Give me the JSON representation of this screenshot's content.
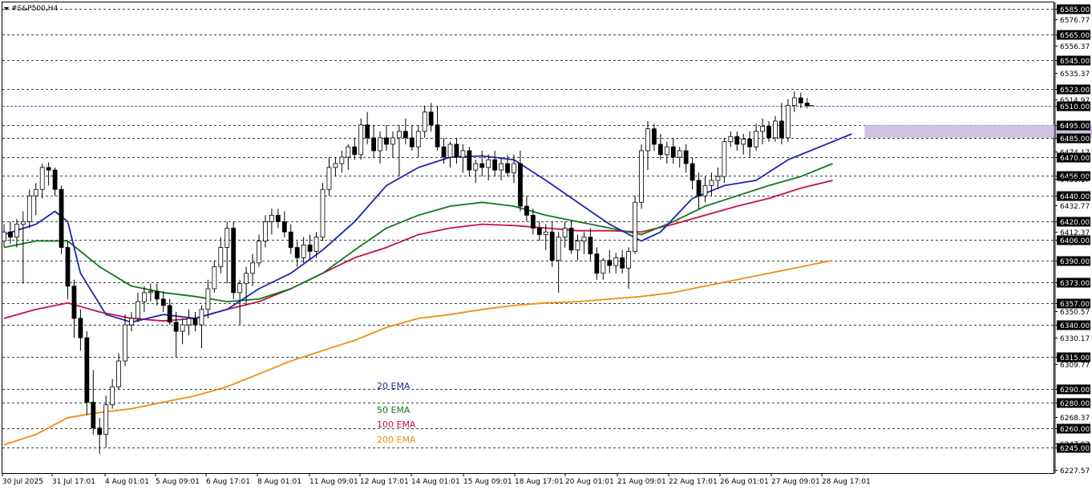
{
  "chart_data": {
    "type": "candlestick",
    "symbol_label": "#S&P500,H4",
    "price_axis": {
      "ylim": [
        6225,
        6590
      ],
      "ticks": [
        {
          "value": 6585.0,
          "label": "6585.00",
          "kind": "level"
        },
        {
          "value": 6576.77,
          "label": "6576.77",
          "kind": "scale"
        },
        {
          "value": 6565.0,
          "label": "6565.00",
          "kind": "level"
        },
        {
          "value": 6556.37,
          "label": "6556.37",
          "kind": "scale"
        },
        {
          "value": 6545.0,
          "label": "6545.00",
          "kind": "level"
        },
        {
          "value": 6535.37,
          "label": "6535.37",
          "kind": "scale"
        },
        {
          "value": 6523.0,
          "label": "6523.00",
          "kind": "level"
        },
        {
          "value": 6514.97,
          "label": "6514.97",
          "kind": "scale"
        },
        {
          "value": 6510.0,
          "label": "6510.00",
          "kind": "price"
        },
        {
          "value": 6495.0,
          "label": "6495.00",
          "kind": "level"
        },
        {
          "value": 6485.0,
          "label": "6485.00",
          "kind": "level"
        },
        {
          "value": 6474.17,
          "label": "6474.17",
          "kind": "scale"
        },
        {
          "value": 6470.0,
          "label": "6470.00",
          "kind": "level"
        },
        {
          "value": 6456.0,
          "label": "6456.00",
          "kind": "level"
        },
        {
          "value": 6453.17,
          "label": "6453.17",
          "kind": "scale"
        },
        {
          "value": 6440.0,
          "label": "6440.00",
          "kind": "level"
        },
        {
          "value": 6432.77,
          "label": "6432.77",
          "kind": "scale"
        },
        {
          "value": 6420.0,
          "label": "6420.00",
          "kind": "level"
        },
        {
          "value": 6412.37,
          "label": "6412.37",
          "kind": "scale"
        },
        {
          "value": 6406.0,
          "label": "6406.00",
          "kind": "level"
        },
        {
          "value": 6390.0,
          "label": "6390.00",
          "kind": "level"
        },
        {
          "value": 6373.0,
          "label": "6373.00",
          "kind": "level"
        },
        {
          "value": 6357.0,
          "label": "6357.00",
          "kind": "level"
        },
        {
          "value": 6350.57,
          "label": "6350.57",
          "kind": "scale"
        },
        {
          "value": 6340.0,
          "label": "6340.00",
          "kind": "level"
        },
        {
          "value": 6330.17,
          "label": "6330.17",
          "kind": "scale"
        },
        {
          "value": 6315.0,
          "label": "6315.00",
          "kind": "level"
        },
        {
          "value": 6309.77,
          "label": "6309.77",
          "kind": "scale"
        },
        {
          "value": 6290.0,
          "label": "6290.00",
          "kind": "level"
        },
        {
          "value": 6280.0,
          "label": "6280.00",
          "kind": "level"
        },
        {
          "value": 6268.37,
          "label": "6268.37",
          "kind": "scale"
        },
        {
          "value": 6260.0,
          "label": "6260.00",
          "kind": "level"
        },
        {
          "value": 6247.97,
          "label": "6247.97",
          "kind": "scale"
        },
        {
          "value": 6245.0,
          "label": "6245.00",
          "kind": "level"
        },
        {
          "value": 6227.57,
          "label": "6227.57",
          "kind": "scale"
        }
      ]
    },
    "time_axis": {
      "labels": [
        "30 Jul 2025",
        "31 Jul 17:01",
        "4 Aug 01:01",
        "5 Aug 09:01",
        "6 Aug 17:01",
        "8 Aug 01:01",
        "11 Aug 09:01",
        "12 Aug 17:01",
        "14 Aug 01:01",
        "15 Aug 09:01",
        "18 Aug 17:01",
        "20 Aug 01:01",
        "21 Aug 09:01",
        "22 Aug 17:01",
        "26 Aug 01:01",
        "27 Aug 09:01",
        "28 Aug 17:01"
      ]
    },
    "zone": {
      "from": 6485,
      "to": 6495,
      "start_bar": 135,
      "end_bar": 173,
      "color": "#c8b8d8"
    },
    "ema_legend": [
      {
        "name": "20 EMA",
        "color": "#1c24b4"
      },
      {
        "name": "50 EMA",
        "color": "#0f7a1a"
      },
      {
        "name": "100 EMA",
        "color": "#cc1040"
      },
      {
        "name": "200 EMA",
        "color": "#f28c10"
      }
    ],
    "candles": [
      [
        6405,
        6418,
        6400,
        6412
      ],
      [
        6412,
        6420,
        6403,
        6408
      ],
      [
        6408,
        6422,
        6400,
        6418
      ],
      [
        6418,
        6428,
        6372,
        6420
      ],
      [
        6420,
        6445,
        6415,
        6440
      ],
      [
        6440,
        6450,
        6425,
        6445
      ],
      [
        6445,
        6465,
        6438,
        6462
      ],
      [
        6462,
        6466,
        6448,
        6460
      ],
      [
        6460,
        6462,
        6440,
        6445
      ],
      [
        6445,
        6448,
        6395,
        6400
      ],
      [
        6400,
        6405,
        6360,
        6370
      ],
      [
        6370,
        6375,
        6330,
        6345
      ],
      [
        6345,
        6352,
        6320,
        6330
      ],
      [
        6330,
        6335,
        6270,
        6280
      ],
      [
        6280,
        6305,
        6255,
        6260
      ],
      [
        6260,
        6268,
        6240,
        6255
      ],
      [
        6255,
        6285,
        6245,
        6278
      ],
      [
        6278,
        6298,
        6275,
        6292
      ],
      [
        6292,
        6318,
        6290,
        6312
      ],
      [
        6312,
        6348,
        6308,
        6340
      ],
      [
        6340,
        6350,
        6335,
        6345
      ],
      [
        6345,
        6365,
        6342,
        6358
      ],
      [
        6358,
        6370,
        6350,
        6365
      ],
      [
        6365,
        6372,
        6358,
        6366
      ],
      [
        6366,
        6372,
        6355,
        6360
      ],
      [
        6360,
        6366,
        6350,
        6355
      ],
      [
        6355,
        6360,
        6340,
        6342
      ],
      [
        6342,
        6350,
        6315,
        6335
      ],
      [
        6335,
        6345,
        6325,
        6340
      ],
      [
        6340,
        6352,
        6332,
        6345
      ],
      [
        6345,
        6350,
        6335,
        6340
      ],
      [
        6340,
        6355,
        6322,
        6352
      ],
      [
        6352,
        6375,
        6345,
        6368
      ],
      [
        6368,
        6390,
        6365,
        6385
      ],
      [
        6385,
        6408,
        6380,
        6400
      ],
      [
        6400,
        6420,
        6372,
        6415
      ],
      [
        6415,
        6420,
        6360,
        6365
      ],
      [
        6365,
        6375,
        6340,
        6372
      ],
      [
        6372,
        6385,
        6355,
        6380
      ],
      [
        6380,
        6395,
        6370,
        6388
      ],
      [
        6388,
        6410,
        6385,
        6405
      ],
      [
        6405,
        6425,
        6400,
        6420
      ],
      [
        6420,
        6430,
        6410,
        6425
      ],
      [
        6425,
        6430,
        6415,
        6420
      ],
      [
        6420,
        6428,
        6408,
        6412
      ],
      [
        6412,
        6418,
        6395,
        6400
      ],
      [
        6400,
        6405,
        6385,
        6392
      ],
      [
        6392,
        6408,
        6388,
        6402
      ],
      [
        6402,
        6410,
        6390,
        6397
      ],
      [
        6397,
        6412,
        6392,
        6408
      ],
      [
        6408,
        6450,
        6405,
        6445
      ],
      [
        6445,
        6470,
        6440,
        6462
      ],
      [
        6462,
        6470,
        6455,
        6465
      ],
      [
        6465,
        6475,
        6458,
        6470
      ],
      [
        6470,
        6480,
        6460,
        6478
      ],
      [
        6478,
        6485,
        6468,
        6472
      ],
      [
        6472,
        6500,
        6468,
        6495
      ],
      [
        6495,
        6505,
        6480,
        6485
      ],
      [
        6485,
        6495,
        6470,
        6475
      ],
      [
        6475,
        6490,
        6465,
        6485
      ],
      [
        6485,
        6495,
        6475,
        6480
      ],
      [
        6480,
        6490,
        6470,
        6485
      ],
      [
        6485,
        6495,
        6455,
        6490
      ],
      [
        6490,
        6500,
        6480,
        6485
      ],
      [
        6485,
        6495,
        6475,
        6478
      ],
      [
        6478,
        6495,
        6470,
        6490
      ],
      [
        6490,
        6510,
        6485,
        6505
      ],
      [
        6505,
        6512,
        6490,
        6495
      ],
      [
        6495,
        6510,
        6475,
        6478
      ],
      [
        6478,
        6485,
        6465,
        6470
      ],
      [
        6470,
        6482,
        6462,
        6480
      ],
      [
        6480,
        6485,
        6465,
        6470
      ],
      [
        6470,
        6480,
        6458,
        6475
      ],
      [
        6475,
        6478,
        6455,
        6460
      ],
      [
        6460,
        6468,
        6450,
        6465
      ],
      [
        6465,
        6475,
        6455,
        6462
      ],
      [
        6462,
        6472,
        6452,
        6468
      ],
      [
        6468,
        6475,
        6455,
        6460
      ],
      [
        6460,
        6470,
        6452,
        6465
      ],
      [
        6465,
        6472,
        6455,
        6458
      ],
      [
        6458,
        6472,
        6450,
        6465
      ],
      [
        6465,
        6475,
        6428,
        6432
      ],
      [
        6432,
        6440,
        6420,
        6425
      ],
      [
        6425,
        6430,
        6410,
        6415
      ],
      [
        6415,
        6420,
        6405,
        6410
      ],
      [
        6410,
        6418,
        6398,
        6412
      ],
      [
        6412,
        6420,
        6385,
        6390
      ],
      [
        6390,
        6412,
        6365,
        6408
      ],
      [
        6408,
        6420,
        6400,
        6415
      ],
      [
        6415,
        6420,
        6395,
        6398
      ],
      [
        6398,
        6410,
        6390,
        6405
      ],
      [
        6405,
        6412,
        6395,
        6408
      ],
      [
        6408,
        6415,
        6390,
        6395
      ],
      [
        6395,
        6400,
        6375,
        6380
      ],
      [
        6380,
        6392,
        6375,
        6390
      ],
      [
        6390,
        6398,
        6380,
        6386
      ],
      [
        6386,
        6396,
        6380,
        6392
      ],
      [
        6392,
        6398,
        6380,
        6384
      ],
      [
        6384,
        6400,
        6368,
        6397
      ],
      [
        6397,
        6440,
        6395,
        6435
      ],
      [
        6435,
        6480,
        6430,
        6475
      ],
      [
        6475,
        6498,
        6460,
        6492
      ],
      [
        6492,
        6496,
        6475,
        6480
      ],
      [
        6480,
        6488,
        6468,
        6472
      ],
      [
        6472,
        6482,
        6465,
        6478
      ],
      [
        6478,
        6485,
        6465,
        6470
      ],
      [
        6470,
        6478,
        6462,
        6475
      ],
      [
        6475,
        6480,
        6458,
        6465
      ],
      [
        6465,
        6470,
        6445,
        6452
      ],
      [
        6452,
        6458,
        6430,
        6440
      ],
      [
        6440,
        6455,
        6435,
        6448
      ],
      [
        6448,
        6458,
        6440,
        6452
      ],
      [
        6452,
        6462,
        6445,
        6455
      ],
      [
        6455,
        6485,
        6450,
        6482
      ],
      [
        6482,
        6490,
        6478,
        6486
      ],
      [
        6486,
        6490,
        6475,
        6480
      ],
      [
        6480,
        6488,
        6472,
        6484
      ],
      [
        6484,
        6490,
        6470,
        6478
      ],
      [
        6478,
        6496,
        6475,
        6490
      ],
      [
        6490,
        6500,
        6480,
        6494
      ],
      [
        6494,
        6498,
        6482,
        6485
      ],
      [
        6485,
        6502,
        6482,
        6498
      ],
      [
        6498,
        6512,
        6480,
        6485
      ],
      [
        6485,
        6515,
        6482,
        6510
      ],
      [
        6510,
        6521,
        6505,
        6516
      ],
      [
        6516,
        6520,
        6508,
        6512
      ],
      [
        6512,
        6516,
        6508,
        6510
      ]
    ],
    "ema": {
      "ema20": [
        [
          0,
          6410
        ],
        [
          5,
          6418
        ],
        [
          8,
          6428
        ],
        [
          10,
          6420
        ],
        [
          12,
          6380
        ],
        [
          16,
          6348
        ],
        [
          20,
          6342
        ],
        [
          25,
          6348
        ],
        [
          30,
          6345
        ],
        [
          35,
          6352
        ],
        [
          40,
          6368
        ],
        [
          45,
          6380
        ],
        [
          50,
          6398
        ],
        [
          55,
          6420
        ],
        [
          60,
          6448
        ],
        [
          65,
          6462
        ],
        [
          70,
          6470
        ],
        [
          75,
          6471
        ],
        [
          80,
          6468
        ],
        [
          85,
          6452
        ],
        [
          90,
          6435
        ],
        [
          95,
          6418
        ],
        [
          100,
          6405
        ],
        [
          103,
          6412
        ],
        [
          108,
          6438
        ],
        [
          113,
          6448
        ],
        [
          118,
          6452
        ],
        [
          123,
          6468
        ],
        [
          128,
          6478
        ],
        [
          133,
          6488
        ]
      ],
      "ema50": [
        [
          0,
          6400
        ],
        [
          5,
          6405
        ],
        [
          10,
          6405
        ],
        [
          15,
          6385
        ],
        [
          20,
          6370
        ],
        [
          25,
          6365
        ],
        [
          30,
          6362
        ],
        [
          35,
          6358
        ],
        [
          40,
          6360
        ],
        [
          45,
          6368
        ],
        [
          50,
          6380
        ],
        [
          55,
          6398
        ],
        [
          60,
          6415
        ],
        [
          65,
          6425
        ],
        [
          70,
          6432
        ],
        [
          75,
          6435
        ],
        [
          80,
          6432
        ],
        [
          85,
          6425
        ],
        [
          90,
          6420
        ],
        [
          95,
          6415
        ],
        [
          100,
          6410
        ],
        [
          105,
          6420
        ],
        [
          110,
          6432
        ],
        [
          115,
          6440
        ],
        [
          120,
          6448
        ],
        [
          125,
          6455
        ],
        [
          130,
          6465
        ]
      ],
      "ema100": [
        [
          0,
          6345
        ],
        [
          5,
          6352
        ],
        [
          10,
          6357
        ],
        [
          15,
          6350
        ],
        [
          20,
          6345
        ],
        [
          25,
          6343
        ],
        [
          30,
          6345
        ],
        [
          35,
          6352
        ],
        [
          40,
          6358
        ],
        [
          45,
          6368
        ],
        [
          50,
          6380
        ],
        [
          55,
          6392
        ],
        [
          60,
          6400
        ],
        [
          65,
          6410
        ],
        [
          70,
          6415
        ],
        [
          75,
          6418
        ],
        [
          80,
          6417
        ],
        [
          85,
          6415
        ],
        [
          90,
          6413
        ],
        [
          95,
          6413
        ],
        [
          100,
          6412
        ],
        [
          105,
          6418
        ],
        [
          110,
          6425
        ],
        [
          115,
          6432
        ],
        [
          120,
          6438
        ],
        [
          125,
          6446
        ],
        [
          130,
          6452
        ]
      ],
      "ema200": [
        [
          0,
          6247
        ],
        [
          5,
          6255
        ],
        [
          10,
          6268
        ],
        [
          15,
          6272
        ],
        [
          20,
          6275
        ],
        [
          25,
          6280
        ],
        [
          30,
          6285
        ],
        [
          35,
          6292
        ],
        [
          40,
          6302
        ],
        [
          45,
          6312
        ],
        [
          50,
          6320
        ],
        [
          55,
          6328
        ],
        [
          60,
          6338
        ],
        [
          65,
          6345
        ],
        [
          70,
          6348
        ],
        [
          75,
          6352
        ],
        [
          80,
          6355
        ],
        [
          85,
          6357
        ],
        [
          90,
          6358
        ],
        [
          95,
          6360
        ],
        [
          100,
          6362
        ],
        [
          105,
          6365
        ],
        [
          110,
          6370
        ],
        [
          115,
          6375
        ],
        [
          120,
          6380
        ],
        [
          125,
          6385
        ],
        [
          130,
          6390
        ]
      ]
    }
  },
  "colors": {
    "bull_body": "#ffffff",
    "bear_body": "#000000",
    "candle_outline": "#000000",
    "grid_dashed": "#000000",
    "price_line": "#1f2a8a",
    "axis_label_box": "#000000",
    "axis_label_text": "#ffffff"
  }
}
